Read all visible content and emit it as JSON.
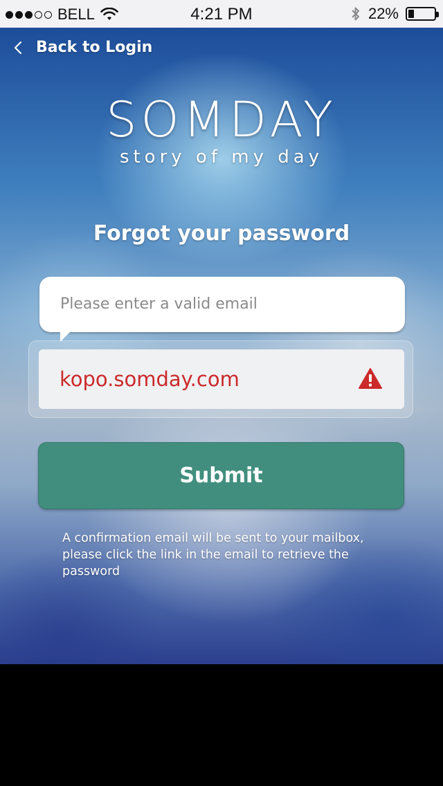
{
  "status_bar": {
    "carrier": "BELL",
    "time": "4:21 PM",
    "battery_percent": "22%",
    "battery_level": 0.22,
    "signal_bars_filled": 3,
    "signal_bars_total": 5
  },
  "nav": {
    "back_label": "Back to Login",
    "back_icon": "chevron-left-icon"
  },
  "brand": {
    "title": "SOMDAY",
    "subtitle": "story of my day"
  },
  "form": {
    "heading": "Forgot your password",
    "error_tooltip": "Please enter a valid email",
    "email_value": "kopo.somday.com",
    "error_icon": "warning-icon",
    "error_color": "#cc2a2a",
    "submit_label": "Submit",
    "submit_color": "#418e7e",
    "note": "A confirmation email will be sent to your mailbox, please click the link in the email to retrieve the password"
  }
}
